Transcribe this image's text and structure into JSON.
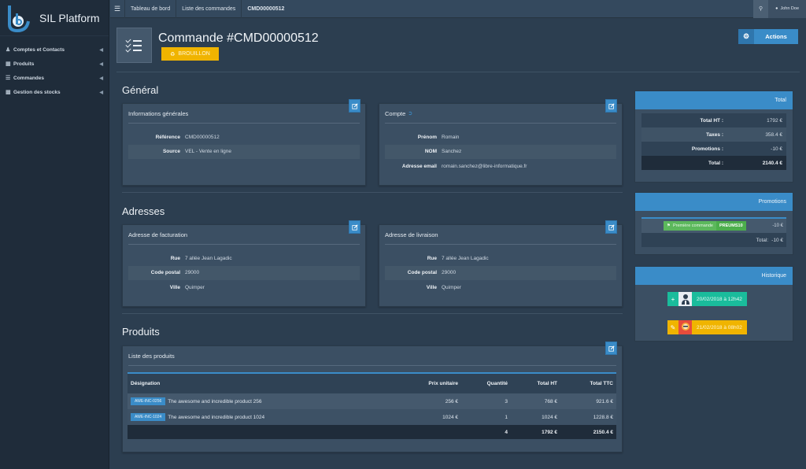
{
  "sidebar": {
    "brand": "SIL Platform",
    "items": [
      {
        "icon": "users-icon",
        "label": "Comptes et Contacts"
      },
      {
        "icon": "cubes-icon",
        "label": "Produits"
      },
      {
        "icon": "list-icon",
        "label": "Commandes"
      },
      {
        "icon": "boxes-icon",
        "label": "Gestion des stocks"
      }
    ]
  },
  "topbar": {
    "breadcrumbs": [
      "Tableau de bord",
      "Liste des commandes",
      "CMD00000512"
    ],
    "user": "John Doe"
  },
  "header": {
    "title": "Commande #CMD00000512",
    "status": "BROUILLON",
    "actions_label": "Actions"
  },
  "sections": {
    "general": "Général",
    "addresses": "Adresses",
    "products": "Produits"
  },
  "general_info": {
    "title": "Informations générales",
    "rows": [
      {
        "label": "Référence",
        "value": "CMD00000512"
      },
      {
        "label": "Source",
        "value": "VEL - Vente en ligne"
      }
    ]
  },
  "account": {
    "title": "Compte",
    "rows": [
      {
        "label": "Prénom",
        "value": "Romain"
      },
      {
        "label": "NOM",
        "value": "Sanchez"
      },
      {
        "label": "Adresse email",
        "value": "romain.sanchez@libre-informatique.fr"
      }
    ]
  },
  "billing": {
    "title": "Adresse de facturation",
    "rows": [
      {
        "label": "Rue",
        "value": "7 allée Jean Lagadic"
      },
      {
        "label": "Code postal",
        "value": "29000"
      },
      {
        "label": "Ville",
        "value": "Quimper"
      }
    ]
  },
  "shipping": {
    "title": "Adresse de livraison",
    "rows": [
      {
        "label": "Rue",
        "value": "7 allée Jean Lagadic"
      },
      {
        "label": "Code postal",
        "value": "29000"
      },
      {
        "label": "Ville",
        "value": "Quimper"
      }
    ]
  },
  "products": {
    "title": "Liste des produits",
    "columns": [
      "Désignation",
      "Prix unitaire",
      "Quantité",
      "Total HT",
      "Total TTC"
    ],
    "rows": [
      {
        "sku": "AWE-INC-0256",
        "name": "The awesome and incredible product 256",
        "unit": "256 €",
        "qty": "3",
        "ht": "768 €",
        "ttc": "921.6 €"
      },
      {
        "sku": "AWE-INC-1024",
        "name": "The awesome and incredible product 1024",
        "unit": "1024 €",
        "qty": "1",
        "ht": "1024 €",
        "ttc": "1228.8 €"
      }
    ],
    "footer": {
      "qty": "4",
      "ht": "1792 €",
      "ttc": "2150.4 €"
    }
  },
  "totals": {
    "title": "Total",
    "rows": [
      {
        "label": "Total HT :",
        "value": "1792 €"
      },
      {
        "label": "Taxes :",
        "value": "358.4 €"
      },
      {
        "label": "Promotions :",
        "value": "-10 €"
      },
      {
        "label": "Total :",
        "value": "2140.4 €"
      }
    ]
  },
  "promotions": {
    "title": "Promotions",
    "name": "Première commande",
    "code": "PREUMS10",
    "amount": "-10 €",
    "total_label": "Total:",
    "total_value": "-10 €"
  },
  "history": {
    "title": "Historique",
    "items": [
      {
        "date": "20/02/2018 à 12h42",
        "icon": "plus-icon",
        "color": "#1abc9c"
      },
      {
        "date": "21/02/2018 à 08h02",
        "icon": "pencil-icon",
        "color": "#f0b400"
      }
    ]
  }
}
